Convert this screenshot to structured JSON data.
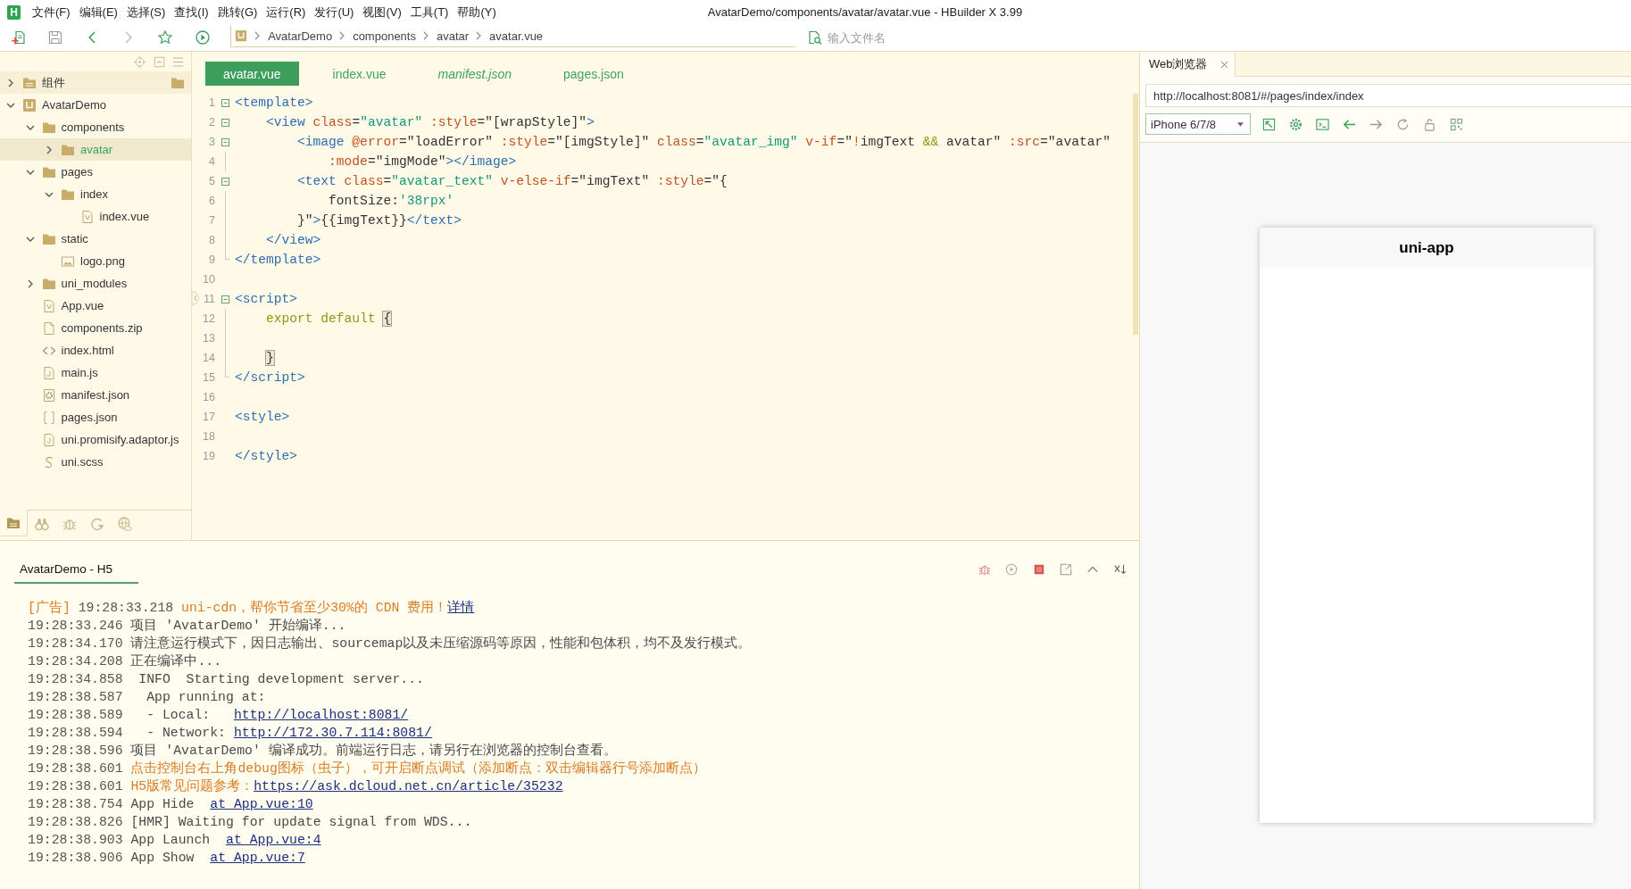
{
  "menu_bar": {
    "logo": "H",
    "items": [
      "文件(F)",
      "编辑(E)",
      "选择(S)",
      "查找(I)",
      "跳转(G)",
      "运行(R)",
      "发行(U)",
      "视图(V)",
      "工具(T)",
      "帮助(Y)"
    ],
    "title": "AvatarDemo/components/avatar/avatar.vue - HBuilder X 3.99"
  },
  "toolbar": {
    "breadcrumb": [
      "AvatarDemo",
      "components",
      "avatar",
      "avatar.vue"
    ],
    "file_search": {
      "placeholder": "输入文件名"
    }
  },
  "sidebar": {
    "tree": [
      {
        "label": "组件",
        "kind": "group",
        "expanded": false,
        "selected": false
      },
      {
        "label": "AvatarDemo",
        "kind": "project",
        "expanded": true,
        "selected": false,
        "children": [
          {
            "label": "components",
            "kind": "folder",
            "expanded": true,
            "selected": false,
            "children": [
              {
                "label": "avatar",
                "kind": "folder",
                "expanded": false,
                "selected": true
              }
            ]
          },
          {
            "label": "pages",
            "kind": "folder",
            "expanded": true,
            "selected": false,
            "children": [
              {
                "label": "index",
                "kind": "folder",
                "expanded": true,
                "selected": false,
                "children": [
                  {
                    "label": "index.vue",
                    "kind": "vue",
                    "selected": false
                  }
                ]
              }
            ]
          },
          {
            "label": "static",
            "kind": "folder",
            "expanded": true,
            "selected": false,
            "children": [
              {
                "label": "logo.png",
                "kind": "image",
                "selected": false
              }
            ]
          },
          {
            "label": "uni_modules",
            "kind": "folder",
            "expanded": false,
            "selected": false
          },
          {
            "label": "App.vue",
            "kind": "vue",
            "selected": false
          },
          {
            "label": "components.zip",
            "kind": "file",
            "selected": false
          },
          {
            "label": "index.html",
            "kind": "html",
            "selected": false
          },
          {
            "label": "main.js",
            "kind": "js",
            "selected": false
          },
          {
            "label": "manifest.json",
            "kind": "manifest",
            "selected": false
          },
          {
            "label": "pages.json",
            "kind": "json",
            "selected": false
          },
          {
            "label": "uni.promisify.adaptor.js",
            "kind": "js",
            "selected": false
          },
          {
            "label": "uni.scss",
            "kind": "scss",
            "selected": false
          }
        ]
      }
    ],
    "views": [
      {
        "kind": "files",
        "selected": true
      },
      {
        "kind": "find",
        "selected": false
      },
      {
        "kind": "debug",
        "selected": false
      },
      {
        "kind": "sync",
        "selected": false
      },
      {
        "kind": "web",
        "selected": false
      }
    ]
  },
  "editor": {
    "tabs": [
      {
        "label": "avatar.vue",
        "selected": true,
        "preview": false
      },
      {
        "label": "index.vue",
        "selected": false,
        "preview": false
      },
      {
        "label": "manifest.json",
        "selected": false,
        "preview": true
      },
      {
        "label": "pages.json",
        "selected": false,
        "preview": false
      }
    ],
    "lines": [
      {
        "number": "1",
        "kind": "toggle",
        "tokens": [
          {
            "kind": "tag",
            "text": "<template>"
          }
        ]
      },
      {
        "number": "2",
        "kind": "toggle",
        "tokens": [
          {
            "kind": "tag",
            "text": "    <view"
          },
          {
            "kind": "attr",
            "text": " class"
          },
          {
            "kind": "plain",
            "text": "="
          },
          {
            "kind": "string",
            "text": "\"avatar\""
          },
          {
            "kind": "attr",
            "text": " :style"
          },
          {
            "kind": "plain",
            "text": "=\"[wrapStyle]\""
          },
          {
            "kind": "tag",
            "text": ">"
          }
        ]
      },
      {
        "number": "3",
        "kind": "toggle",
        "tokens": [
          {
            "kind": "tag",
            "text": "        <image"
          },
          {
            "kind": "attr",
            "text": " @error"
          },
          {
            "kind": "plain",
            "text": "=\"loadError\""
          },
          {
            "kind": "attr",
            "text": " :style"
          },
          {
            "kind": "plain",
            "text": "=\"[imgStyle]\""
          },
          {
            "kind": "attr",
            "text": " class"
          },
          {
            "kind": "plain",
            "text": "="
          },
          {
            "kind": "string",
            "text": "\"avatar_img\""
          },
          {
            "kind": "attr",
            "text": " v-if"
          },
          {
            "kind": "plain",
            "text": "=\""
          },
          {
            "kind": "attr",
            "text": "!"
          },
          {
            "kind": "plain",
            "text": "imgText "
          },
          {
            "kind": "keyword",
            "text": "&&"
          },
          {
            "kind": "plain",
            "text": " avatar\""
          },
          {
            "kind": "attr",
            "text": " :src"
          },
          {
            "kind": "plain",
            "text": "=\"avatar\""
          }
        ]
      },
      {
        "number": "4",
        "kind": "inside",
        "tokens": [
          {
            "kind": "attr",
            "text": "            :mode"
          },
          {
            "kind": "plain",
            "text": "=\"imgMode\""
          },
          {
            "kind": "tag",
            "text": "></image>"
          }
        ]
      },
      {
        "number": "5",
        "kind": "toggle",
        "tokens": [
          {
            "kind": "tag",
            "text": "        <text"
          },
          {
            "kind": "attr",
            "text": " class"
          },
          {
            "kind": "plain",
            "text": "="
          },
          {
            "kind": "string",
            "text": "\"avatar_text\""
          },
          {
            "kind": "attr",
            "text": " v-else-if"
          },
          {
            "kind": "plain",
            "text": "=\"imgText\""
          },
          {
            "kind": "attr",
            "text": " :style"
          },
          {
            "kind": "plain",
            "text": "=\"{"
          }
        ]
      },
      {
        "number": "6",
        "kind": "inside",
        "tokens": [
          {
            "kind": "plain",
            "text": "            fontSize:"
          },
          {
            "kind": "string",
            "text": "'38rpx'"
          }
        ]
      },
      {
        "number": "7",
        "kind": "inside",
        "tokens": [
          {
            "kind": "plain",
            "text": "        }\""
          },
          {
            "kind": "tag",
            "text": ">"
          },
          {
            "kind": "plain",
            "text": "{{imgText}}"
          },
          {
            "kind": "tag",
            "text": "</text>"
          }
        ]
      },
      {
        "number": "8",
        "kind": "inside",
        "tokens": [
          {
            "kind": "tag",
            "text": "    </view>"
          }
        ]
      },
      {
        "number": "9",
        "kind": "last",
        "tokens": [
          {
            "kind": "tag",
            "text": "</template>"
          }
        ]
      },
      {
        "number": "10",
        "kind": "plain"
      },
      {
        "number": "11",
        "kind": "toggle",
        "tokens": [
          {
            "kind": "tag",
            "text": "<script>"
          }
        ]
      },
      {
        "number": "12",
        "kind": "inside",
        "tokens": [
          {
            "kind": "keyword",
            "text": "    export default "
          },
          {
            "kind": "bracket",
            "text": "{"
          }
        ]
      },
      {
        "number": "13",
        "kind": "inside"
      },
      {
        "number": "14",
        "kind": "inside",
        "tokens": [
          {
            "kind": "bracket",
            "text": "    }"
          }
        ]
      },
      {
        "number": "15",
        "kind": "last",
        "tokens": [
          {
            "kind": "tag",
            "text": "</script>"
          }
        ]
      },
      {
        "number": "16",
        "kind": "plain"
      },
      {
        "number": "17",
        "kind": "plain",
        "tokens": [
          {
            "kind": "tag",
            "text": "<style>"
          }
        ]
      },
      {
        "number": "18",
        "kind": "plain"
      },
      {
        "number": "19",
        "kind": "plain",
        "tokens": [
          {
            "kind": "tag",
            "text": "</style>"
          }
        ]
      }
    ]
  },
  "browser": {
    "tab": {
      "label": "Web浏览器",
      "selected": true
    },
    "url": "http://localhost:8081/#/pages/index/index",
    "device": "iPhone 6/7/8",
    "page_title": "uni-app"
  },
  "console": {
    "tab": {
      "label": "AvatarDemo - H5",
      "selected": true
    },
    "lines": [
      {
        "kind": "ad",
        "prefix": "[广告]",
        "time": "19:28:33.218",
        "text": "uni-cdn，帮你节省至少30%的 CDN 费用！",
        "link": "详情"
      },
      {
        "kind": "normal",
        "time": "19:28:33.246",
        "text": "项目 'AvatarDemo' 开始编译..."
      },
      {
        "kind": "normal",
        "time": "19:28:34.170",
        "text": "请注意运行模式下，因日志输出、sourcemap以及未压缩源码等原因，性能和包体积，均不及发行模式。"
      },
      {
        "kind": "normal",
        "time": "19:28:34.208",
        "text": "正在编译中..."
      },
      {
        "kind": "normal",
        "time": "19:28:34.858",
        "text": " INFO  Starting development server..."
      },
      {
        "kind": "normal",
        "time": "19:28:38.587",
        "text": "  App running at:"
      },
      {
        "kind": "normal",
        "time": "19:28:38.589",
        "text": "  - Local:   ",
        "link": "http://localhost:8081/"
      },
      {
        "kind": "normal",
        "time": "19:28:38.594",
        "text": "  - Network: ",
        "link": "http://172.30.7.114:8081/"
      },
      {
        "kind": "normal",
        "time": "19:28:38.596",
        "text": "项目 'AvatarDemo' 编译成功。前端运行日志，请另行在浏览器的控制台查看。"
      },
      {
        "kind": "warn",
        "time": "19:28:38.601",
        "text": "点击控制台右上角debug图标（虫子），可开启断点调试（添加断点：双击编辑器行号添加断点）"
      },
      {
        "kind": "warn",
        "time": "19:28:38.601",
        "text": "H5版常见问题参考：",
        "link": "https://ask.dcloud.net.cn/article/35232"
      },
      {
        "kind": "normal",
        "time": "19:28:38.754",
        "text": "App Hide  ",
        "link": "at App.vue:10"
      },
      {
        "kind": "normal",
        "time": "19:28:38.826",
        "text": "[HMR] Waiting for update signal from WDS..."
      },
      {
        "kind": "normal",
        "time": "19:28:38.903",
        "text": "App Launch  ",
        "link": "at App.vue:4"
      },
      {
        "kind": "normal",
        "time": "19:28:38.906",
        "text": "App Show  ",
        "link": "at App.vue:7"
      }
    ]
  }
}
